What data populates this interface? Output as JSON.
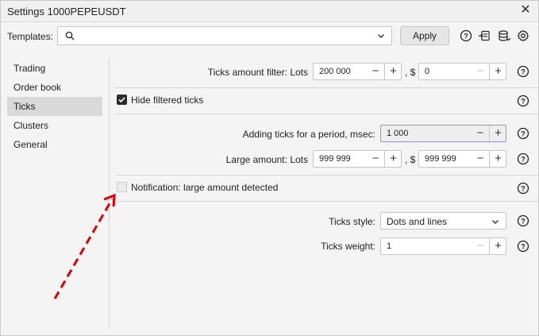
{
  "window": {
    "title": "Settings 1000PEPEUSDT"
  },
  "templates": {
    "label": "Templates:",
    "search_value": "",
    "apply_label": "Apply"
  },
  "toolbar_icons": [
    "help-icon",
    "export-icon",
    "database-icon",
    "gear-icon"
  ],
  "sidebar": {
    "items": [
      {
        "label": "Trading",
        "active": false
      },
      {
        "label": "Order book",
        "active": false
      },
      {
        "label": "Ticks",
        "active": true
      },
      {
        "label": "Clusters",
        "active": false
      },
      {
        "label": "General",
        "active": false
      }
    ]
  },
  "ticks": {
    "filter": {
      "label": "Ticks amount filter: Lots",
      "lots": "200 000",
      "sep": ", $",
      "usd": "0"
    },
    "hide_filtered": {
      "label": "Hide filtered ticks",
      "checked": true
    },
    "adding_period": {
      "label": "Adding ticks for a period, msec:",
      "value": "1 000"
    },
    "large_amount": {
      "label": "Large amount: Lots",
      "lots": "999 999",
      "sep": ", $",
      "usd": "999 999"
    },
    "notification": {
      "label": "Notification: large amount detected",
      "checked": false
    },
    "style": {
      "label": "Ticks style:",
      "value": "Dots and lines"
    },
    "weight": {
      "label": "Ticks weight:",
      "value": "1"
    }
  },
  "colors": {
    "accent_focus": "#9d8fd0",
    "annotation_arrow": "#e00000",
    "active_nav": "#d9d9d9"
  }
}
